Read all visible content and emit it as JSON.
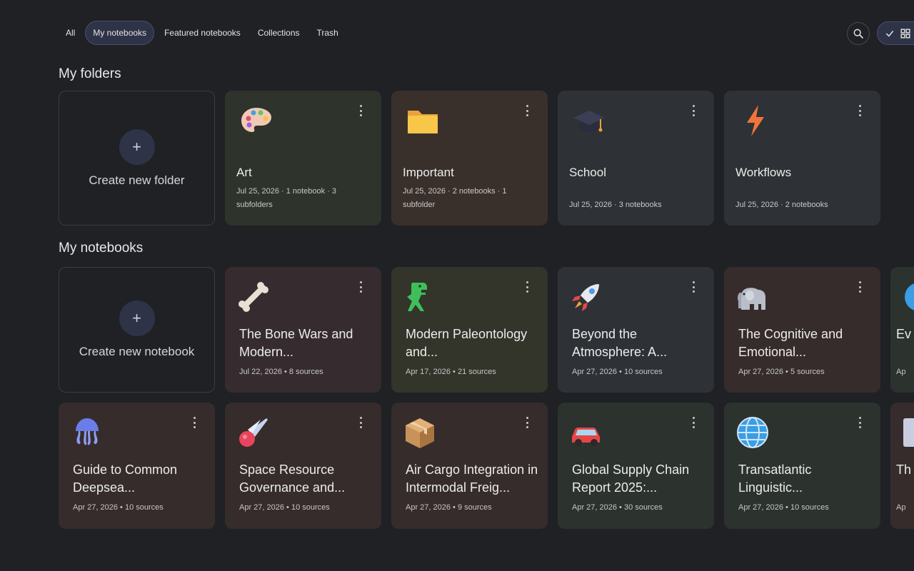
{
  "tabs": [
    {
      "label": "All",
      "active": false
    },
    {
      "label": "My notebooks",
      "active": true
    },
    {
      "label": "Featured notebooks",
      "active": false
    },
    {
      "label": "Collections",
      "active": false
    },
    {
      "label": "Trash",
      "active": false
    }
  ],
  "folders_section": {
    "title": "My folders",
    "create_label": "Create new folder",
    "create_icon": "+",
    "items": [
      {
        "title": "Art",
        "meta": "Jul 25, 2026 · 1 notebook · 3 subfolders",
        "icon": "palette-icon",
        "bg": "#2e332b"
      },
      {
        "title": "Important",
        "meta": "Jul 25, 2026 · 2 notebooks · 1 subfolder",
        "icon": "folder-icon",
        "bg": "#3a302b"
      },
      {
        "title": "School",
        "meta": "Jul 25, 2026 · 3 notebooks",
        "icon": "graduation-cap-icon",
        "bg": "#2e3135"
      },
      {
        "title": "Workflows",
        "meta": "Jul 25, 2026 · 2 notebooks",
        "icon": "lightning-icon",
        "bg": "#2e3135"
      }
    ]
  },
  "notebooks_section": {
    "title": "My notebooks",
    "create_label": "Create new notebook",
    "create_icon": "+",
    "row1": [
      {
        "title": "The Bone Wars and Modern...",
        "meta": "Jul 22, 2026 • 8 sources",
        "icon": "bone-icon",
        "bg": "#362c30"
      },
      {
        "title": "Modern Paleontology and...",
        "meta": "Apr 17, 2026 • 21 sources",
        "icon": "t-rex-icon",
        "bg": "#33342a"
      },
      {
        "title": "Beyond the Atmosphere: A...",
        "meta": "Apr 27, 2026 • 10 sources",
        "icon": "rocket-icon",
        "bg": "#2e3135"
      },
      {
        "title": "The Cognitive and Emotional...",
        "meta": "Apr 27, 2026 • 5 sources",
        "icon": "elephant-icon",
        "bg": "#362c2b"
      },
      {
        "title": "Ev W",
        "meta": "Ap",
        "icon": "globe-icon",
        "bg": "#2c322e"
      }
    ],
    "row2": [
      {
        "title": "Guide to Common Deepsea...",
        "meta": "Apr 27, 2026 • 10 sources",
        "icon": "jellyfish-icon",
        "bg": "#362c2b"
      },
      {
        "title": "Space Resource Governance and...",
        "meta": "Apr 27, 2026 • 10 sources",
        "icon": "comet-icon",
        "bg": "#362c2b"
      },
      {
        "title": "Air Cargo Integration in Intermodal Freig...",
        "meta": "Apr 27, 2026 • 9 sources",
        "icon": "package-icon",
        "bg": "#362c2b"
      },
      {
        "title": "Global Supply Chain Report 2025:...",
        "meta": "Apr 27, 2026 • 30 sources",
        "icon": "car-icon",
        "bg": "#2c322e"
      },
      {
        "title": "Transatlantic Linguistic...",
        "meta": "Apr 27, 2026 • 10 sources",
        "icon": "globe-icon",
        "bg": "#2c322e"
      },
      {
        "title": "Th In",
        "meta": "Ap",
        "icon": "chart-icon",
        "bg": "#362c2b"
      }
    ]
  }
}
